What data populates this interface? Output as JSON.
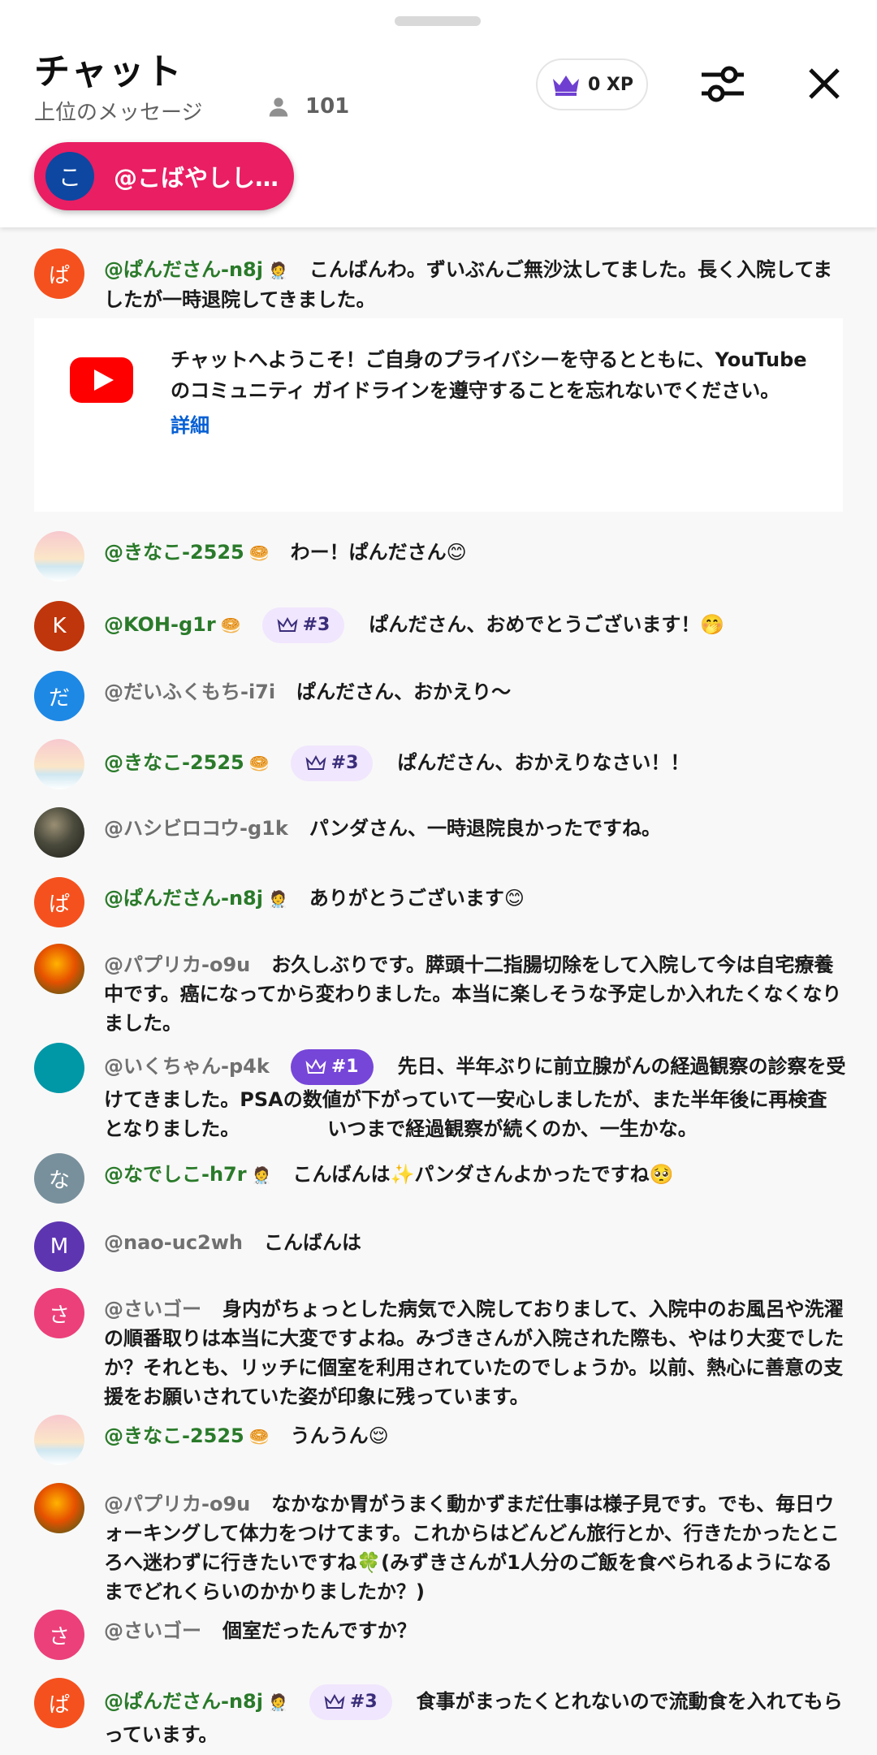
{
  "header": {
    "title": "チャット",
    "subtitle": "上位のメッセージ",
    "viewer_count": "101",
    "xp_label": "0 XP"
  },
  "pinned": {
    "avatar_letter": "こ",
    "name": "@こばやしし…"
  },
  "notice": {
    "text": "チャットへようこそ！ご自身のプライバシーを守るとともに、YouTube のコミュニティ ガイドラインを遵守することを忘れないでください。",
    "link": "詳細"
  },
  "messages": [
    {
      "avatar": "ぱ",
      "author": "@ぱんださん-n8j",
      "badge": "🧑‍⚕️",
      "rank": "",
      "text": "こんばんわ。ずいぶんご無沙汰してました。長く入院してましたが一時退院してきました。"
    },
    {
      "avatar": "",
      "author": "@きなこ-2525",
      "badge": "🥯",
      "rank": "",
      "text": "わー！ぱんださん😊"
    },
    {
      "avatar": "K",
      "author": "@KOH-g1r",
      "badge": "🥯",
      "rank": "#3",
      "text": "ぱんださん、おめでとうございます！🤭"
    },
    {
      "avatar": "だ",
      "author": "@だいふくもち-i7i",
      "badge": "",
      "rank": "",
      "text": "ぱんださん、おかえり〜"
    },
    {
      "avatar": "",
      "author": "@きなこ-2525",
      "badge": "🥯",
      "rank": "#3",
      "text": "ぱんださん、おかえりなさい！！"
    },
    {
      "avatar": "",
      "author": "@ハシビロコウ-g1k",
      "badge": "",
      "rank": "",
      "text": "パンダさん、一時退院良かったですね。"
    },
    {
      "avatar": "ぱ",
      "author": "@ぱんださん-n8j",
      "badge": "🧑‍⚕️",
      "rank": "",
      "text": "ありがとうございます😊"
    },
    {
      "avatar": "",
      "author": "@パプリカ-o9u",
      "badge": "",
      "rank": "",
      "text": "お久しぶりです。膵頭十二指腸切除をして入院して今は自宅療養中です。癌になってから変わりました。本当に楽しそうな予定しか入れたくなくなりました。"
    },
    {
      "avatar": "",
      "author": "@いくちゃん-p4k",
      "badge": "",
      "rank": "#1",
      "text": "先日、半年ぶりに前立腺がんの経過観察の診察を受けてきました。PSAの数値が下がっていて一安心しましたが、また半年後に再検査となりました。　　　　　いつまで経過観察が続くのか、一生かな。"
    },
    {
      "avatar": "な",
      "author": "@なでしこ-h7r",
      "badge": "🧑‍⚕️",
      "rank": "",
      "text": "こんばんは✨パンダさんよかったですね🥺"
    },
    {
      "avatar": "M",
      "author": "@nao-uc2wh",
      "badge": "",
      "rank": "",
      "text": "こんばんは"
    },
    {
      "avatar": "さ",
      "author": "@さいゴー",
      "badge": "",
      "rank": "",
      "text": "身内がちょっとした病気で入院しておりまして、入院中のお風呂や洗濯の順番取りは本当に大変ですよね。みづきさんが入院された際も、やはり大変でしたか？それとも、リッチに個室を利用されていたのでしょうか。以前、熱心に善意の支援をお願いされていた姿が印象に残っています。"
    },
    {
      "avatar": "",
      "author": "@きなこ-2525",
      "badge": "🥯",
      "rank": "",
      "text": "うんうん😌"
    },
    {
      "avatar": "",
      "author": "@パプリカ-o9u",
      "badge": "",
      "rank": "",
      "text": "なかなか胃がうまく動かずまだ仕事は様子見です。でも、毎日ウォーキングして体力をつけてます。これからはどんどん旅行とか、行きたかったところへ迷わずに行きたいですね🍀(みずきさんが1人分のご飯を食べられるようになるまでどれくらいのかかりましたか？)"
    },
    {
      "avatar": "さ",
      "author": "@さいゴー",
      "badge": "",
      "rank": "",
      "text": "個室だったんですか？"
    },
    {
      "avatar": "ぱ",
      "author": "@ぱんださん-n8j",
      "badge": "🧑‍⚕️",
      "rank": "#3",
      "text": "食事がまったくとれないので流動食を入れてもらっています。"
    }
  ],
  "colors": {
    "accent_pink": "#e91e63",
    "member_green": "#2a7a2a",
    "link_blue": "#065fd4",
    "rank_purple": "#7646d8"
  }
}
